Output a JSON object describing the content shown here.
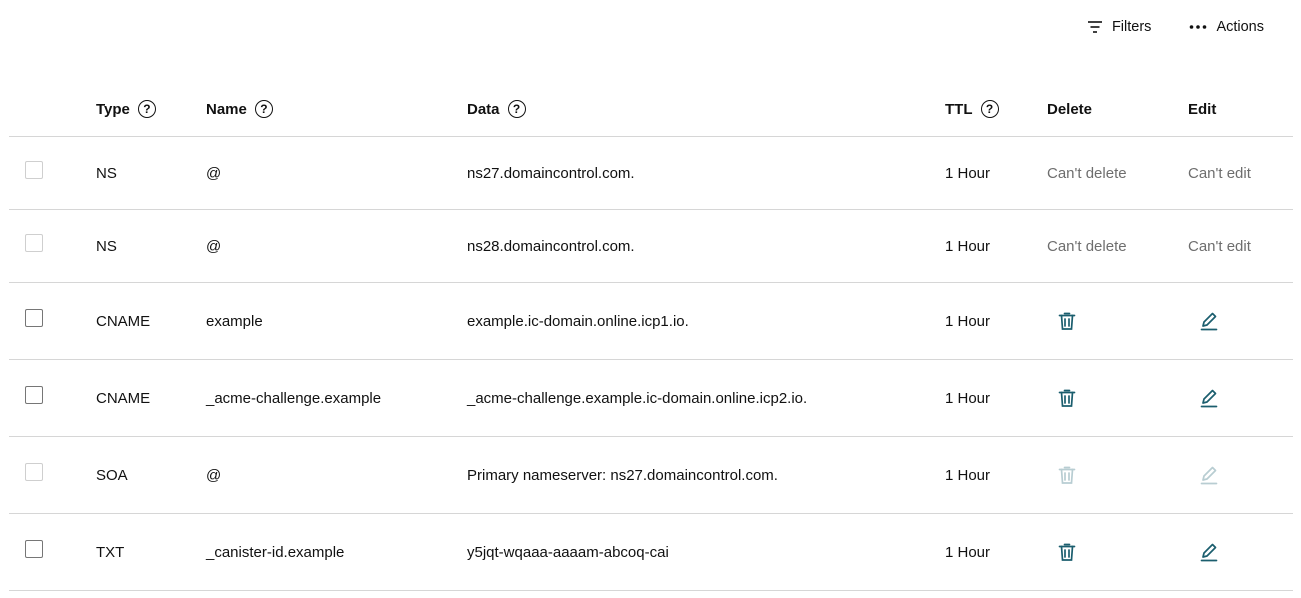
{
  "toolbar": {
    "filters_label": "Filters",
    "actions_label": "Actions"
  },
  "columns": {
    "type": "Type",
    "name": "Name",
    "data": "Data",
    "ttl": "TTL",
    "delete": "Delete",
    "edit": "Edit",
    "help_glyph": "?"
  },
  "rows": [
    {
      "type": "NS",
      "name": "@",
      "data": "ns27.domaincontrol.com.",
      "ttl": "1 Hour",
      "delete_text": "Can't delete",
      "edit_text": "Can't edit"
    },
    {
      "type": "NS",
      "name": "@",
      "data": "ns28.domaincontrol.com.",
      "ttl": "1 Hour",
      "delete_text": "Can't delete",
      "edit_text": "Can't edit"
    },
    {
      "type": "CNAME",
      "name": "example",
      "data": "example.ic-domain.online.icp1.io.",
      "ttl": "1 Hour",
      "delete_icon": "trash-icon",
      "edit_icon": "pencil-icon"
    },
    {
      "type": "CNAME",
      "name": "_acme-challenge.example",
      "data": "_acme-challenge.example.ic-domain.online.icp2.io.",
      "ttl": "1 Hour",
      "delete_icon": "trash-icon",
      "edit_icon": "pencil-icon"
    },
    {
      "type": "SOA",
      "name": "@",
      "data": "Primary nameserver: ns27.domaincontrol.com.",
      "ttl": "1 Hour",
      "delete_icon": "trash-icon",
      "edit_icon": "pencil-icon",
      "disabled": true
    },
    {
      "type": "TXT",
      "name": "_canister-id.example",
      "data": "y5jqt-wqaaa-aaaam-abcoq-cai",
      "ttl": "1 Hour",
      "delete_icon": "trash-icon",
      "edit_icon": "pencil-icon"
    }
  ],
  "colors": {
    "icon_active": "#1b5e6e",
    "icon_disabled": "#b8cdd2",
    "muted_text": "#6e6e6e",
    "row_divider": "#d6d6d6"
  }
}
